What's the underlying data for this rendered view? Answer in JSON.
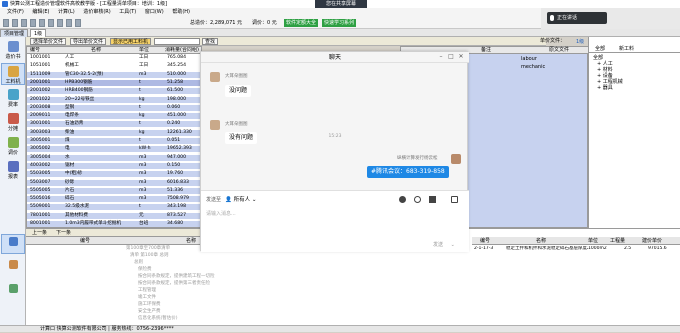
{
  "window_title": "快算公测工程造价管理软件高校教学版 - [工程量清单项目：培训：1级]",
  "share_badge": "您在共享屏幕",
  "menu": [
    "文件(F)",
    "编辑(E)",
    "计算(L)",
    "造价审核(R)",
    "工具(T)",
    "窗口(W)",
    "帮助(H)"
  ],
  "toolbar": {
    "total_label": "总造价：2,289,071 元",
    "adjust_label": "调价：0 元",
    "btn_a": "软件定额大全",
    "btn_b": "快速学习系列"
  },
  "tabs": {
    "project": "项目管理",
    "tab1": "1级"
  },
  "leftnav": [
    {
      "label": "造价书"
    },
    {
      "label": "工料机"
    },
    {
      "label": "费率"
    },
    {
      "label": "分摊"
    },
    {
      "label": "调价"
    },
    {
      "label": "报表"
    }
  ],
  "subbar": {
    "b1": "选择单价文件",
    "b2": "导出单价文件",
    "b3": "显示已用工料机",
    "b4": "查找",
    "unit_price_file_label": "单价文件：",
    "unit_price_file_value": "1级"
  },
  "grid": {
    "headers": [
      "编号",
      "名称",
      "单位",
      "消耗量(合同组)"
    ],
    "rows": [
      {
        "code": "1001001",
        "name": "人工",
        "unit": "工日",
        "qty": "765.084"
      },
      {
        "code": "1051001",
        "name": "机械工",
        "unit": "工日",
        "qty": "345.254"
      },
      {
        "code": "1511009",
        "name": "管C30-32.5-2(预)",
        "unit": "m3",
        "qty": "510.000"
      },
      {
        "code": "2001001",
        "name": "HPB300钢筋",
        "unit": "t",
        "qty": "51.258"
      },
      {
        "code": "2001002",
        "name": "HRB400钢筋",
        "unit": "t",
        "qty": "61.500"
      },
      {
        "code": "2001022",
        "name": "20~22号铁丝",
        "unit": "kg",
        "qty": "198.000"
      },
      {
        "code": "2003008",
        "name": "型钢",
        "unit": "t",
        "qty": "0.060"
      },
      {
        "code": "2009011",
        "name": "电焊条",
        "unit": "kg",
        "qty": "451.000"
      },
      {
        "code": "3001001",
        "name": "石油沥青",
        "unit": "t",
        "qty": "0.240"
      },
      {
        "code": "3003003",
        "name": "柴油",
        "unit": "kg",
        "qty": "12261.330"
      },
      {
        "code": "3005001",
        "name": "煤",
        "unit": "t",
        "qty": "0.051"
      },
      {
        "code": "3005002",
        "name": "电",
        "unit": "kW·h",
        "qty": "19652.393"
      },
      {
        "code": "3005004",
        "name": "水",
        "unit": "m3",
        "qty": "947.000"
      },
      {
        "code": "4003002",
        "name": "锯材",
        "unit": "m3",
        "qty": "0.150"
      },
      {
        "code": "5503005",
        "name": "中(粗)砂",
        "unit": "m3",
        "qty": "19.760"
      },
      {
        "code": "5503007",
        "name": "砂砾",
        "unit": "m3",
        "qty": "6016.833"
      },
      {
        "code": "5505005",
        "name": "片石",
        "unit": "m3",
        "qty": "51.336"
      },
      {
        "code": "5505016",
        "name": "碎石",
        "unit": "m3",
        "qty": "7508.979"
      },
      {
        "code": "5509001",
        "name": "32.5级水泥",
        "unit": "t",
        "qty": "343.198"
      },
      {
        "code": "7801001",
        "name": "其他材料费",
        "unit": "元",
        "qty": "873.527"
      },
      {
        "code": "8001001",
        "name": "1.0m3内履带式单斗挖掘机",
        "unit": "台班",
        "qty": "34.680"
      }
    ]
  },
  "right_panel": {
    "headers": [
      "备注",
      "原文文件",
      "造"
    ],
    "rows": [
      {
        "col": "labour"
      },
      {
        "col": "mechanic"
      }
    ]
  },
  "far_right": {
    "tabs": [
      "全部",
      "新工料"
    ],
    "tree": [
      "全部",
      "+ 人工",
      "+ 材料",
      "+ 设备",
      "+ 工程机械",
      "+ 器具"
    ]
  },
  "bottom": {
    "tabs": [
      "上一条",
      "下一条"
    ],
    "headers_left": [
      "编号",
      "名称"
    ],
    "rows_left": [
      "第100章至700章清单",
      "清单 第100章 总则",
      "总则",
      "保险费",
      "按合同条款规定，提供建筑工程一切险",
      "按合同条款规定，提供第三者责任险",
      "工程管理",
      "竣工文件",
      "施工环保费",
      "安全生产费",
      "信息化系统(暂估价)"
    ],
    "headers_right": [
      "编号",
      "名称",
      "单位",
      "工程量",
      "建价单价"
    ],
    "row_right": {
      "code": "2-1-17-3",
      "name": "稳定土拌和机拌和水泥稳定碎石基层厚度20cm",
      "unit": "1000m2",
      "qty": "2.5",
      "price": "97015.6"
    }
  },
  "status_bar": "计算口 快算公测软件有限公司 | 服务热线：0756-2396****",
  "chat": {
    "title": "聊天",
    "messages": [
      {
        "sender": "大耳朵图图",
        "text": "没问题"
      },
      {
        "timestamp": "15:23"
      },
      {
        "sender": "大耳朵图图",
        "text": "没有问题"
      },
      {
        "sender": "纵横计算发行杨云松",
        "text": "#腾讯会议：683-319-858",
        "me": true
      }
    ],
    "send_to_label": "发送至",
    "recipient": "所有人",
    "input_placeholder": "请输入消息...",
    "send_button": "发送"
  },
  "tray": {
    "live_text": "正在讲话"
  },
  "colors": {
    "row_blue": "#c7d2ef",
    "accent_blue": "#1e88e5",
    "green": "#2ea043"
  }
}
